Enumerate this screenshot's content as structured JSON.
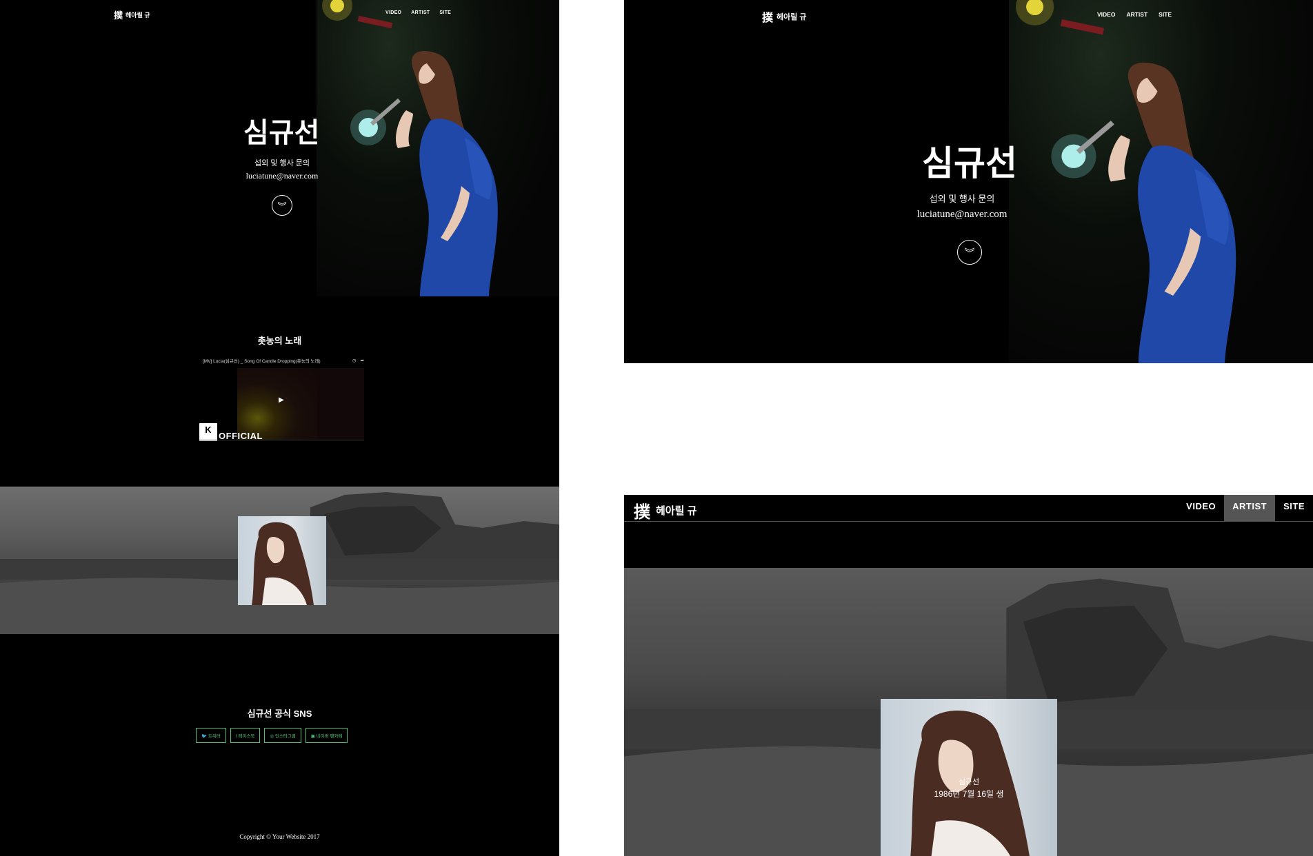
{
  "nav": {
    "logo_mark": "撲",
    "logo_text": "헤아릴 규",
    "items": [
      "VIDEO",
      "ARTIST",
      "SITE"
    ],
    "active": "ARTIST"
  },
  "hero": {
    "title": "심규선",
    "subtitle": "섭외 및 행사 문의",
    "email": "luciatune@naver.com",
    "scroll_icon": "double-chevron-down-icon"
  },
  "video": {
    "heading": "촛농의 노래",
    "title": "[MV] Lucia(심규선) _ Song Of Candle Dropping(촛농의 노래)",
    "badge_letter": "K",
    "badge_small": "1theK",
    "badge_text": "OFFICIAL"
  },
  "artist": {
    "name": "심규선",
    "dob": "1986년 7월 16일 생"
  },
  "sns": {
    "heading": "심규선 공식 SNS",
    "links": [
      {
        "icon": "twitter-icon",
        "glyph": "🐦",
        "label": "트위터"
      },
      {
        "icon": "facebook-icon",
        "glyph": "f",
        "label": "페이스북"
      },
      {
        "icon": "instagram-icon",
        "glyph": "◎",
        "label": "인스타그램"
      },
      {
        "icon": "naver-cafe-icon",
        "glyph": "▣",
        "label": "네이버 팬카페"
      }
    ],
    "accent": "#4ec07a"
  },
  "footer": {
    "copyright": "Copyright © Your Website 2017"
  }
}
